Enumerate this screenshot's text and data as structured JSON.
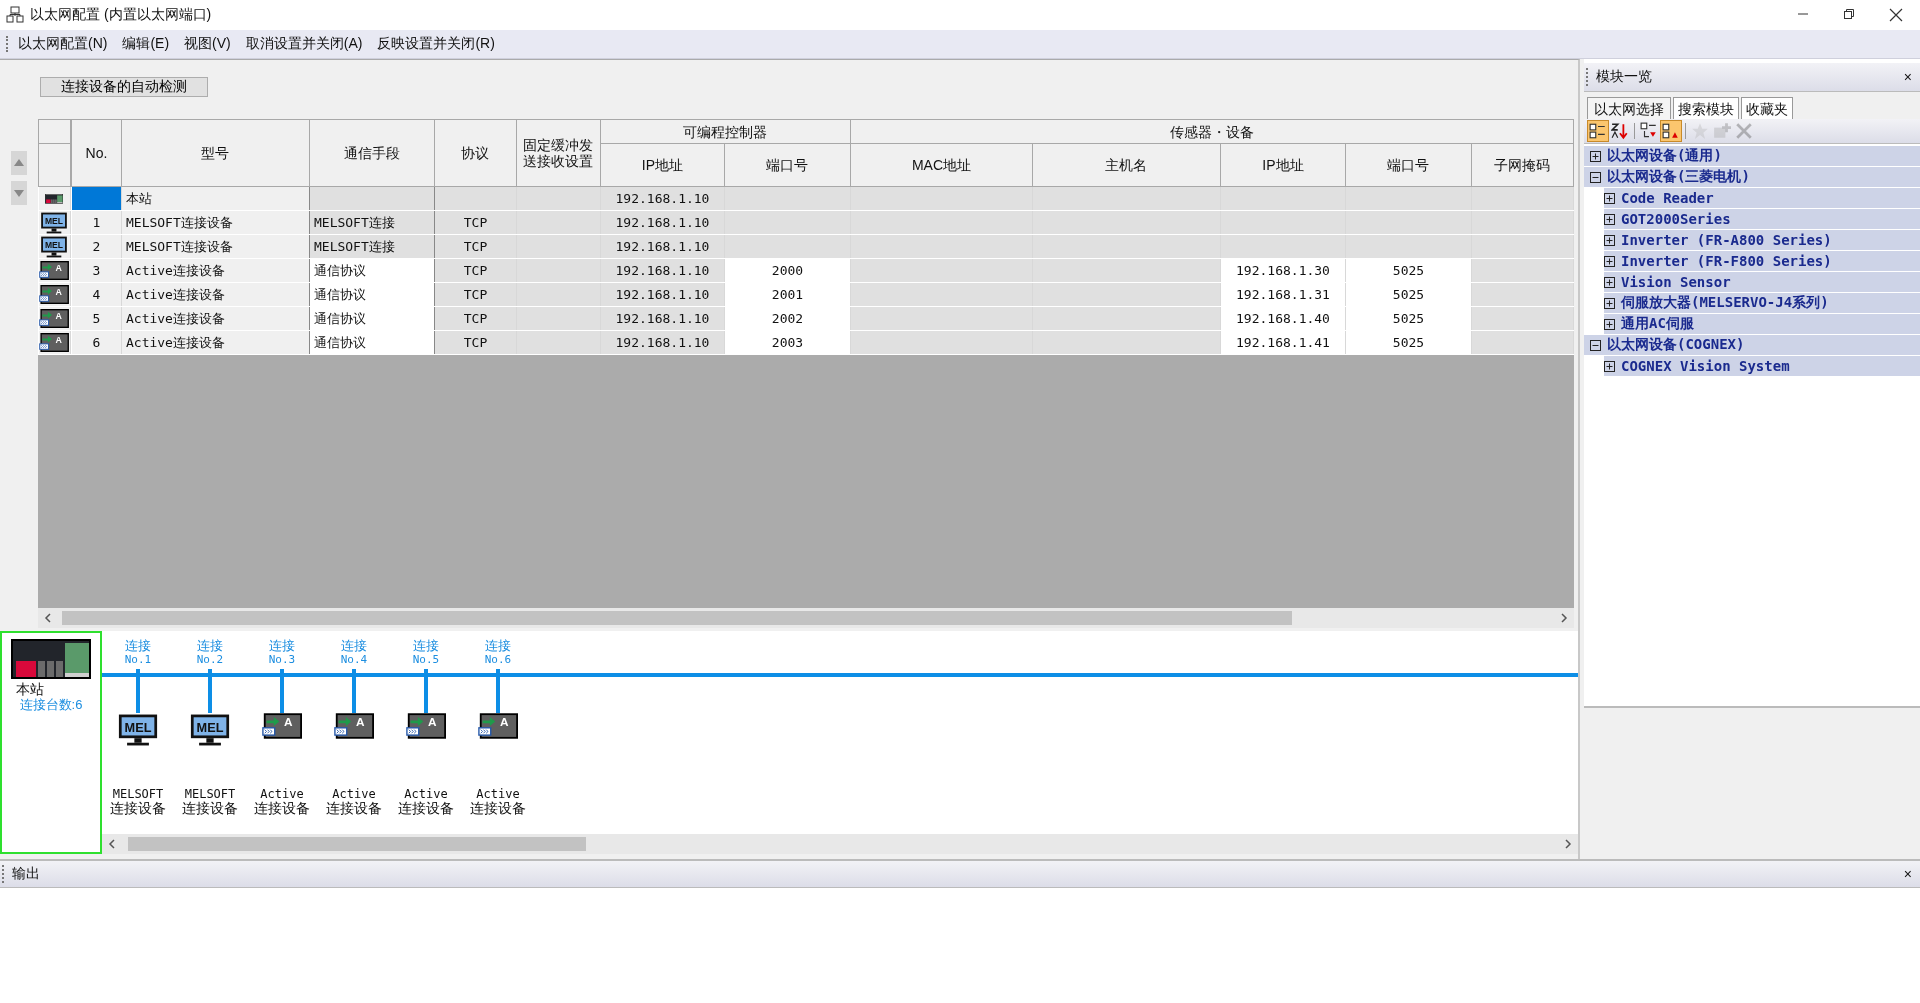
{
  "window": {
    "title": "以太网配置 (内置以太网端口)"
  },
  "menu": [
    "以太网配置(N)",
    "编辑(E)",
    "视图(V)",
    "取消设置并关闭(A)",
    "反映设置并关闭(R)"
  ],
  "auto_detect_button": "连接设备的自动检测",
  "table": {
    "columns": [
      {
        "label": "No."
      },
      {
        "label": "型号"
      },
      {
        "label": "通信手段"
      },
      {
        "label": "协议"
      },
      {
        "label": "固定缓冲发送接收设置"
      },
      {
        "label": "可编程控制器",
        "colspan": 2,
        "children": [
          "IP地址",
          "端口号"
        ]
      },
      {
        "label": "传感器・设备",
        "colspan": 5,
        "children": [
          "MAC地址",
          "主机名",
          "IP地址",
          "端口号",
          "子网掩码"
        ]
      }
    ],
    "rows": [
      {
        "kind": "station",
        "selected": true,
        "cells": [
          {
            "editable": false
          },
          {
            "text": "本站",
            "editable": false
          },
          {
            "editable": false
          },
          {
            "editable": false
          },
          {
            "editable": false
          },
          {
            "text": "192.168.1.10",
            "editable": false
          },
          {
            "editable": false
          },
          {
            "editable": false
          },
          {
            "editable": false
          },
          {
            "editable": false
          },
          {
            "editable": false
          },
          {
            "editable": false
          }
        ]
      },
      {
        "kind": "melsoft",
        "icon_label": "MEL",
        "selected": false,
        "cells": [
          {
            "text": "1",
            "editable": false
          },
          {
            "text": "MELSOFT连接设备",
            "editable": false
          },
          {
            "text": "MELSOFT连接",
            "editable": false
          },
          {
            "text": "TCP",
            "editable": false
          },
          {
            "editable": false
          },
          {
            "text": "192.168.1.10",
            "editable": false
          },
          {
            "editable": false
          },
          {
            "editable": false
          },
          {
            "editable": false
          },
          {
            "editable": false
          },
          {
            "editable": false
          },
          {
            "editable": false
          }
        ]
      },
      {
        "kind": "melsoft",
        "icon_label": "MEL",
        "selected": false,
        "cells": [
          {
            "text": "2",
            "editable": false
          },
          {
            "text": "MELSOFT连接设备",
            "editable": false
          },
          {
            "text": "MELSOFT连接",
            "editable": false
          },
          {
            "text": "TCP",
            "editable": false
          },
          {
            "editable": false
          },
          {
            "text": "192.168.1.10",
            "editable": false
          },
          {
            "editable": false
          },
          {
            "editable": false
          },
          {
            "editable": false
          },
          {
            "editable": false
          },
          {
            "editable": false
          },
          {
            "editable": false
          }
        ]
      },
      {
        "kind": "active",
        "icon_label": "A",
        "selected": false,
        "cells": [
          {
            "text": "3",
            "editable": false
          },
          {
            "text": "Active连接设备",
            "editable": false
          },
          {
            "text": "通信协议",
            "editable": true
          },
          {
            "text": "TCP",
            "editable": false
          },
          {
            "editable": false
          },
          {
            "text": "192.168.1.10",
            "editable": false
          },
          {
            "text": "2000",
            "editable": true
          },
          {
            "editable": false
          },
          {
            "editable": false
          },
          {
            "text": "192.168.1.30",
            "editable": true
          },
          {
            "text": "5025",
            "editable": true
          },
          {
            "editable": false
          }
        ]
      },
      {
        "kind": "active",
        "icon_label": "A",
        "selected": false,
        "cells": [
          {
            "text": "4",
            "editable": false
          },
          {
            "text": "Active连接设备",
            "editable": false
          },
          {
            "text": "通信协议",
            "editable": true
          },
          {
            "text": "TCP",
            "editable": false
          },
          {
            "editable": false
          },
          {
            "text": "192.168.1.10",
            "editable": false
          },
          {
            "text": "2001",
            "editable": true
          },
          {
            "editable": false
          },
          {
            "editable": false
          },
          {
            "text": "192.168.1.31",
            "editable": true
          },
          {
            "text": "5025",
            "editable": true
          },
          {
            "editable": false
          }
        ]
      },
      {
        "kind": "active",
        "icon_label": "A",
        "selected": false,
        "cells": [
          {
            "text": "5",
            "editable": false
          },
          {
            "text": "Active连接设备",
            "editable": false
          },
          {
            "text": "通信协议",
            "editable": true
          },
          {
            "text": "TCP",
            "editable": false
          },
          {
            "editable": false
          },
          {
            "text": "192.168.1.10",
            "editable": false
          },
          {
            "text": "2002",
            "editable": true
          },
          {
            "editable": false
          },
          {
            "editable": false
          },
          {
            "text": "192.168.1.40",
            "editable": true
          },
          {
            "text": "5025",
            "editable": true
          },
          {
            "editable": false
          }
        ]
      },
      {
        "kind": "active",
        "icon_label": "A",
        "selected": false,
        "cells": [
          {
            "text": "6",
            "editable": false
          },
          {
            "text": "Active连接设备",
            "editable": false
          },
          {
            "text": "通信协议",
            "editable": true
          },
          {
            "text": "TCP",
            "editable": false
          },
          {
            "editable": false
          },
          {
            "text": "192.168.1.10",
            "editable": false
          },
          {
            "text": "2003",
            "editable": true
          },
          {
            "editable": false
          },
          {
            "editable": false
          },
          {
            "text": "192.168.1.41",
            "editable": true
          },
          {
            "text": "5025",
            "editable": true
          },
          {
            "editable": false
          }
        ]
      }
    ]
  },
  "diagram": {
    "station": {
      "label": "本站",
      "count": "连接台数:6"
    },
    "devices": [
      {
        "kind": "melsoft",
        "icon_label": "MEL",
        "link": "连接",
        "number": "No.1",
        "name": [
          "MELSOFT",
          "连接设备"
        ]
      },
      {
        "kind": "melsoft",
        "icon_label": "MEL",
        "link": "连接",
        "number": "No.2",
        "name": [
          "MELSOFT",
          "连接设备"
        ]
      },
      {
        "kind": "active",
        "icon_label": "A",
        "link": "连接",
        "number": "No.3",
        "name": [
          "Active",
          "连接设备"
        ]
      },
      {
        "kind": "active",
        "icon_label": "A",
        "link": "连接",
        "number": "No.4",
        "name": [
          "Active",
          "连接设备"
        ]
      },
      {
        "kind": "active",
        "icon_label": "A",
        "link": "连接",
        "number": "No.5",
        "name": [
          "Active",
          "连接设备"
        ]
      },
      {
        "kind": "active",
        "icon_label": "A",
        "link": "连接",
        "number": "No.6",
        "name": [
          "Active",
          "连接设备"
        ]
      }
    ]
  },
  "module_list": {
    "title": "模块一览",
    "close": "×",
    "tabs": [
      {
        "label": "以太网选择",
        "selected": true
      },
      {
        "label": "搜索模块",
        "selected": false
      },
      {
        "label": "收藏夹",
        "selected": false
      }
    ],
    "toolbar": [
      {
        "kind": "category",
        "on": true,
        "disabled": false
      },
      {
        "kind": "sort",
        "on": false,
        "disabled": false
      },
      {
        "kind": "collapse",
        "on": false,
        "disabled": false
      },
      {
        "kind": "expand",
        "on": true,
        "disabled": false
      },
      {
        "kind": "star",
        "on": false,
        "disabled": true
      },
      {
        "kind": "add",
        "on": false,
        "disabled": true
      },
      {
        "kind": "delete",
        "on": false,
        "disabled": true
      }
    ],
    "tree": [
      {
        "label": "以太网设备(通用)",
        "expanded": false
      },
      {
        "label": "以太网设备(三菱电机)",
        "expanded": true,
        "children": [
          {
            "label": "Code Reader",
            "expanded": false
          },
          {
            "label": "GOT2000Series",
            "expanded": false
          },
          {
            "label": "Inverter (FR-A800 Series)",
            "expanded": false
          },
          {
            "label": "Inverter (FR-F800 Series)",
            "expanded": false
          },
          {
            "label": "Vision Sensor",
            "expanded": false
          },
          {
            "label": "伺服放大器(MELSERVO-J4系列)",
            "expanded": false
          },
          {
            "label": "通用AC伺服",
            "expanded": false
          }
        ]
      },
      {
        "label": "以太网设备(COGNEX)",
        "expanded": true,
        "children": [
          {
            "label": "COGNEX Vision System",
            "expanded": false
          }
        ]
      }
    ]
  },
  "output": {
    "title": "输出",
    "close": "×"
  }
}
